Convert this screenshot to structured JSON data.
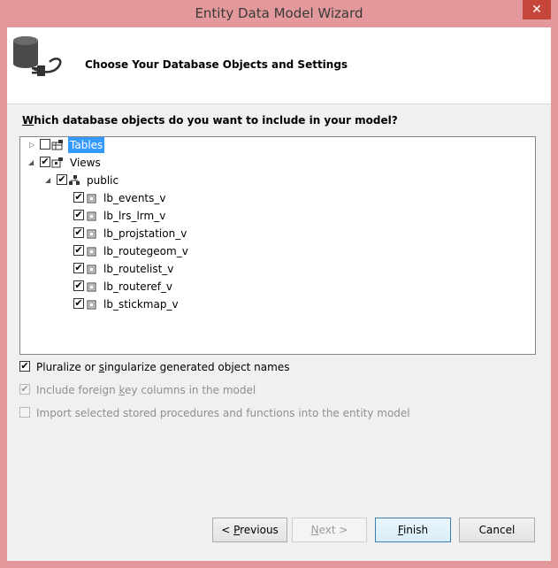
{
  "window": {
    "title": "Entity Data Model Wizard",
    "close_glyph": "✕"
  },
  "header": {
    "title": "Choose Your Database Objects and Settings",
    "icon": "database-plug-icon"
  },
  "question": {
    "accel": "W",
    "rest": "hich database objects do you want to include in your model?"
  },
  "tree": {
    "tables": {
      "label": "Tables",
      "checked": false,
      "expanded": false
    },
    "views": {
      "label": "Views",
      "checked": true,
      "expanded": true
    },
    "schema": {
      "label": "public",
      "checked": true
    },
    "items": [
      {
        "label": "lb_events_v"
      },
      {
        "label": "lb_lrs_lrm_v"
      },
      {
        "label": "lb_projstation_v"
      },
      {
        "label": "lb_routegeom_v"
      },
      {
        "label": "lb_routelist_v"
      },
      {
        "label": "lb_routeref_v"
      },
      {
        "label": "lb_stickmap_v"
      }
    ],
    "check_glyph": "✔"
  },
  "options": {
    "pluralize": {
      "pre": "Pluralize or ",
      "accel": "s",
      "post": "ingularize generated object names",
      "checked": true
    },
    "foreign_keys": {
      "pre": "Include foreign ",
      "accel": "k",
      "post": "ey columns in the model",
      "checked": true,
      "disabled": true
    },
    "stored_procs": {
      "label": "Import selected stored procedures and functions into the entity model",
      "checked": false,
      "disabled": true
    }
  },
  "buttons": {
    "previous": {
      "pre": "< ",
      "accel": "P",
      "post": "revious"
    },
    "next": {
      "accel": "N",
      "post": "ext >"
    },
    "finish": {
      "accel": "F",
      "post": "inish"
    },
    "cancel": "Cancel"
  }
}
